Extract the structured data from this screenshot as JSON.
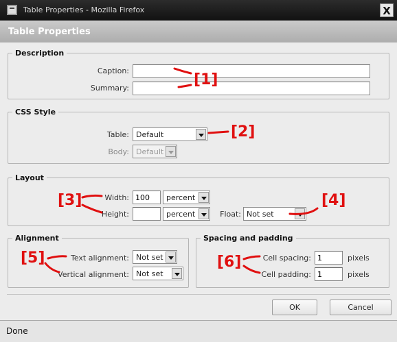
{
  "window": {
    "title": "Table Properties - Mozilla Firefox",
    "close_glyph": "X"
  },
  "dialog": {
    "title": "Table Properties"
  },
  "description": {
    "legend": "Description",
    "caption_label": "Caption:",
    "caption_value": "",
    "summary_label": "Summary:",
    "summary_value": ""
  },
  "css_style": {
    "legend": "CSS Style",
    "table_label": "Table:",
    "table_value": "Default",
    "body_label": "Body:",
    "body_value": "Default"
  },
  "layout": {
    "legend": "Layout",
    "width_label": "Width:",
    "width_value": "100",
    "width_unit": "percent",
    "height_label": "Height:",
    "height_value": "",
    "height_unit": "percent",
    "float_label": "Float:",
    "float_value": "Not set"
  },
  "alignment": {
    "legend": "Alignment",
    "text_label": "Text alignment:",
    "text_value": "Not set",
    "vertical_label": "Vertical alignment:",
    "vertical_value": "Not set"
  },
  "spacing": {
    "legend": "Spacing and padding",
    "spacing_label": "Cell spacing:",
    "spacing_value": "1",
    "spacing_unit": "pixels",
    "padding_label": "Cell padding:",
    "padding_value": "1",
    "padding_unit": "pixels"
  },
  "buttons": {
    "ok": "OK",
    "cancel": "Cancel"
  },
  "status": {
    "text": "Done"
  },
  "annotations": {
    "a1": "[1]",
    "a2": "[2]",
    "a3": "[3]",
    "a4": "[4]",
    "a5": "[5]",
    "a6": "[6]"
  },
  "colors": {
    "annotation": "#e01010",
    "titlebar": "#1c1c1c",
    "header": "#b8b8b8"
  }
}
